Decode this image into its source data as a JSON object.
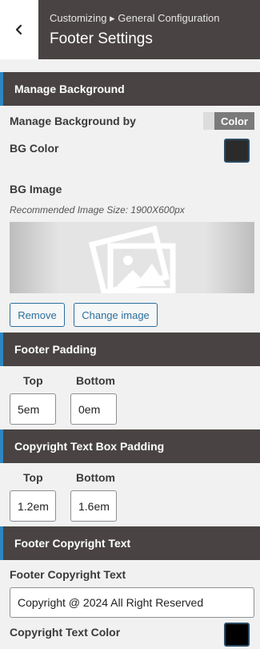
{
  "header": {
    "breadcrumb": "Customizing ▸ General Configuration",
    "title": "Footer Settings"
  },
  "sections": {
    "background": {
      "heading": "Manage Background",
      "manage_by_label": "Manage Background by",
      "manage_by_value": "Color",
      "bg_color_label": "BG Color",
      "bg_color_value": "#2b2b2b",
      "bg_image_label": "BG Image",
      "bg_image_hint": "Recommended Image Size: 1900X600px",
      "remove_label": "Remove",
      "change_image_label": "Change image"
    },
    "footer_padding": {
      "heading": "Footer Padding",
      "top_label": "Top",
      "top_value": "5em",
      "bottom_label": "Bottom",
      "bottom_value": "0em"
    },
    "copyright_padding": {
      "heading": "Copyright Text Box Padding",
      "top_label": "Top",
      "top_value": "1.2em",
      "bottom_label": "Bottom",
      "bottom_value": "1.6em"
    },
    "copyright_text": {
      "heading": "Footer Copyright Text",
      "text_label": "Footer Copyright Text",
      "text_value": "Copyright @ 2024 All Right Reserved",
      "color_label": "Copyright Text Color",
      "color_value": "#000000"
    }
  },
  "colors": {
    "header_bg": "#494443",
    "accent": "#2e86c1",
    "button_text": "#2c6f9c"
  },
  "icons": {
    "back": "chevron-left-icon",
    "placeholder": "image-placeholder-icon"
  }
}
